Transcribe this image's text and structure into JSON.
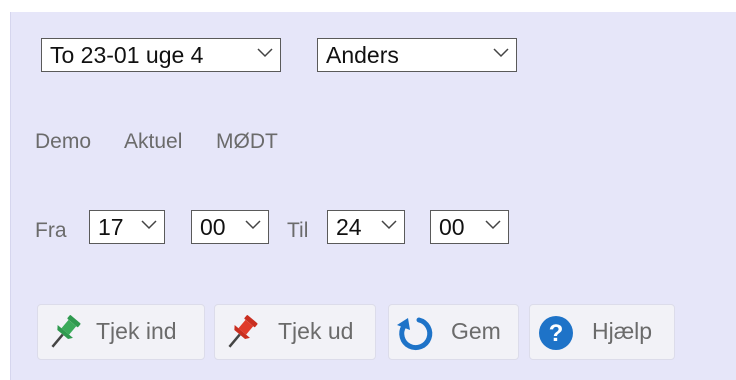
{
  "header": {
    "partial_title": ""
  },
  "form": {
    "day_select": {
      "value": "To 23-01 uge 4"
    },
    "person_select": {
      "value": "Anders"
    },
    "status_labels": [
      "Demo",
      "Aktuel",
      "MØDT"
    ],
    "from_label": "Fra",
    "from_hour": "17",
    "from_minute": "00",
    "to_label": "Til",
    "to_hour": "24",
    "to_minute": "00"
  },
  "buttons": {
    "checkin": "Tjek ind",
    "checkout": "Tjek ud",
    "save": "Gem",
    "help": "Hjælp"
  },
  "icons": {
    "checkin": "green-pushpin-icon",
    "checkout": "red-pushpin-icon",
    "save": "refresh-icon",
    "help": "question-mark-icon"
  },
  "colors": {
    "panel_bg": "#e6e6f9",
    "pin_green": "#2f9a4f",
    "pin_red": "#e03a2a",
    "accent_blue": "#1e73c8"
  }
}
